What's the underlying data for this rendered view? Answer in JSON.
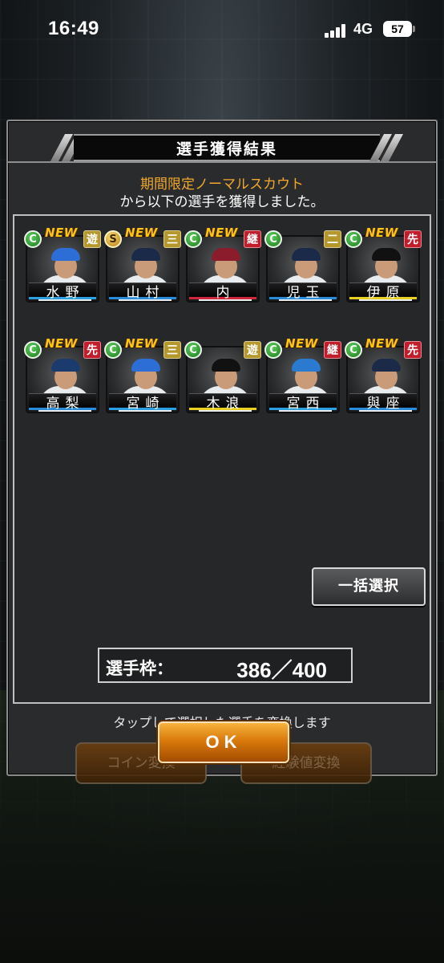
{
  "status_bar": {
    "time": "16:49",
    "network": "4G",
    "battery": "57"
  },
  "dialog": {
    "title": "選手獲得結果",
    "scout_name": "期間限定ノーマルスカウト",
    "result_message": "から以下の選手を獲得しました。",
    "players": [
      {
        "name": "水野",
        "rank": "C",
        "position": "遊",
        "position_color": "#b5982c",
        "new_label": "NEW",
        "cap_color": "#2c6ed6",
        "stripe_color": "#2aa0e0"
      },
      {
        "name": "山村",
        "rank": "S",
        "position": "三",
        "position_color": "#b5982c",
        "new_label": "NEW",
        "cap_color": "#1c2a4a",
        "stripe_color": "#2a8bd8"
      },
      {
        "name": "内",
        "rank": "C",
        "position": "継",
        "position_color": "#c21d2a",
        "new_label": "NEW",
        "cap_color": "#8a1c2c",
        "stripe_color": "#d0283a"
      },
      {
        "name": "児玉",
        "rank": "C",
        "position": "二",
        "position_color": "#b5982c",
        "new_label": "",
        "cap_color": "#1c2a4a",
        "stripe_color": "#2a8bd8"
      },
      {
        "name": "伊原",
        "rank": "C",
        "position": "先",
        "position_color": "#c21d2a",
        "new_label": "NEW",
        "cap_color": "#111111",
        "stripe_color": "#e8d020"
      },
      {
        "name": "高梨",
        "rank": "C",
        "position": "先",
        "position_color": "#c21d2a",
        "new_label": "NEW",
        "cap_color": "#1b3a6e",
        "stripe_color": "#2a8bd8"
      },
      {
        "name": "宮崎",
        "rank": "C",
        "position": "三",
        "position_color": "#b5982c",
        "new_label": "NEW",
        "cap_color": "#2c6ed6",
        "stripe_color": "#2aa0e0"
      },
      {
        "name": "木浪",
        "rank": "C",
        "position": "遊",
        "position_color": "#b5982c",
        "new_label": "",
        "cap_color": "#111111",
        "stripe_color": "#e8d020"
      },
      {
        "name": "宮西",
        "rank": "C",
        "position": "継",
        "position_color": "#c21d2a",
        "new_label": "NEW",
        "cap_color": "#2a7ad0",
        "stripe_color": "#2aa0e0"
      },
      {
        "name": "與座",
        "rank": "C",
        "position": "先",
        "position_color": "#c21d2a",
        "new_label": "NEW",
        "cap_color": "#1c2a4a",
        "stripe_color": "#2a8bd8"
      }
    ],
    "bulk_select_label": "一括選択",
    "slot_label": "選手枠：",
    "slot_value": "386／400",
    "convert_hint": "タップして選択した選手を変換します",
    "coin_convert_label": "コイン変換",
    "exp_convert_label": "経験値変換",
    "ok_label": "OK"
  }
}
